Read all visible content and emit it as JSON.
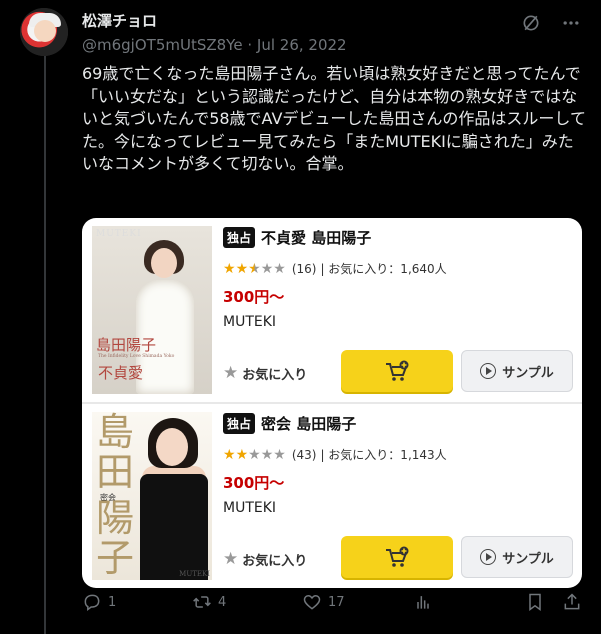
{
  "author": {
    "name": "松澤チョロ",
    "handle": "@m6gjOT5mUtSZ8Ye",
    "separator": "·",
    "date": "Jul 26, 2022"
  },
  "tweet": {
    "text": "69歳で亡くなった島田陽子さん。若い頃は熟女好きだと思ってたんで「いい女だな」という認識だったけど、自分は本物の熟女好きではないと気づいたんで58歳でAVデビューした島田さんの作品はスルーしてた。今になってレビュー見てみたら「またMUTEKIに騙された」みたいなコメントが多くて切ない。合掌。"
  },
  "card": {
    "products": [
      {
        "badge": "独占",
        "title": "不貞愛 島田陽子",
        "stars_filled": 2.5,
        "review_count": "(16)",
        "fav_text": "| お気に入り：1,640人",
        "price": "300円〜",
        "maker": "MUTEKI",
        "fav_button": "お気に入り",
        "sample_button": "サンプル",
        "cover": {
          "brand": "MUTEKI",
          "title_top": "島田陽子",
          "subtitle": "The Infidelity Love Shimada Yoko",
          "title_bottom": "不貞愛"
        }
      },
      {
        "badge": "独占",
        "title": "密会 島田陽子",
        "stars_filled": 2,
        "review_count": "(43)",
        "fav_text": "| お気に入り：1,143人",
        "price": "300円〜",
        "maker": "MUTEKI",
        "fav_button": "お気に入り",
        "sample_button": "サンプル",
        "cover": {
          "c1": "島",
          "c2": "田",
          "c3": "陽",
          "c4": "子",
          "small": "密会",
          "brand": "MUTEKI"
        }
      }
    ]
  },
  "actions": {
    "reply_count": "1",
    "retweet_count": "4",
    "like_count": "17"
  },
  "icons": {
    "header": [
      "grok-icon",
      "more-icon"
    ],
    "actions": [
      "reply-icon",
      "retweet-icon",
      "like-icon",
      "views-icon",
      "bookmark-icon",
      "share-icon"
    ]
  },
  "colors": {
    "background": "#000000",
    "text": "#e7e9ea",
    "muted": "#71767b",
    "price": "#c60000",
    "cart_button": "#f6d21a",
    "star": "#f0a500"
  }
}
